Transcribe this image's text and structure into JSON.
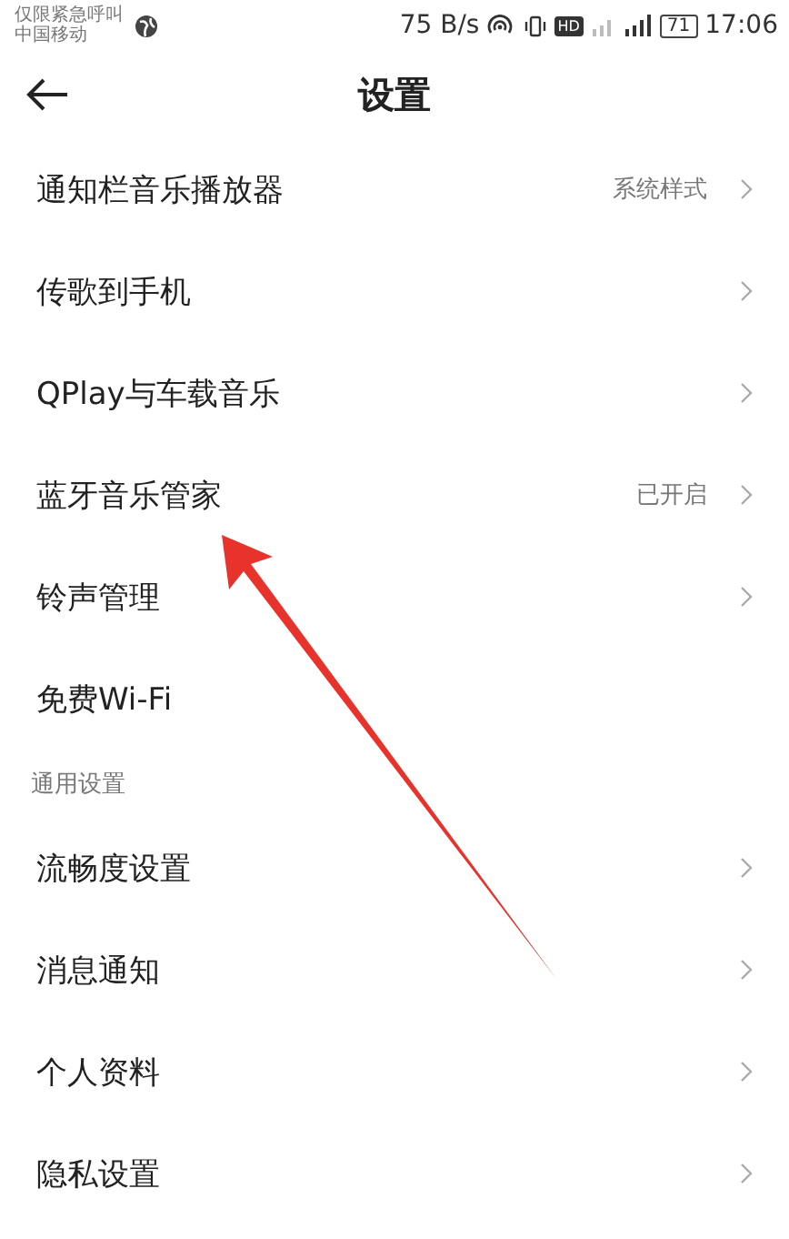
{
  "status_bar": {
    "carrier_notice": "仅限紧急呼叫",
    "carrier": "中国移动",
    "speed": "75 B/s",
    "hd": "HD",
    "battery": "71",
    "time": "17:06"
  },
  "header": {
    "title": "设置"
  },
  "items": [
    {
      "kind": "item",
      "label": "通知栏音乐播放器",
      "value": "系统样式",
      "chevron": true
    },
    {
      "kind": "item",
      "label": "传歌到手机",
      "chevron": true
    },
    {
      "kind": "item",
      "label": "QPlay与车载音乐",
      "chevron": true
    },
    {
      "kind": "item",
      "label": "蓝牙音乐管家",
      "value": "已开启",
      "chevron": true
    },
    {
      "kind": "item",
      "label": "铃声管理",
      "chevron": true
    },
    {
      "kind": "item",
      "label": "免费Wi-Fi",
      "chevron": false
    },
    {
      "kind": "header",
      "label": "通用设置"
    },
    {
      "kind": "item",
      "label": "流畅度设置",
      "chevron": true
    },
    {
      "kind": "item",
      "label": "消息通知",
      "chevron": true
    },
    {
      "kind": "item",
      "label": "个人资料",
      "chevron": true
    },
    {
      "kind": "item",
      "label": "隐私设置",
      "chevron": true
    }
  ]
}
